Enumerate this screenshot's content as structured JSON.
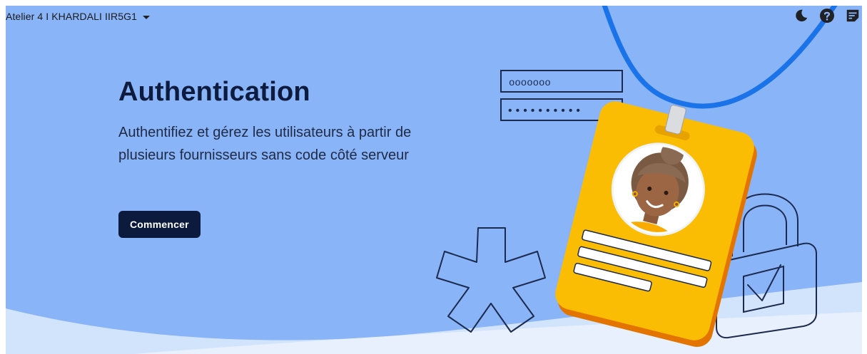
{
  "header": {
    "project_name": "Atelier 4 I KHARDALI IIR5G1",
    "icons": [
      "moon-icon",
      "help-icon",
      "feedback-icon"
    ]
  },
  "hero": {
    "title": "Authentication",
    "description": "Authentifiez et gérez les utilisateurs à partir de plusieurs fournisseurs sans code côté serveur",
    "cta_label": "Commencer"
  },
  "illustration": {
    "username_field": "ooooooo",
    "password_field": "••••••••••"
  },
  "colors": {
    "hero_background": "#8ab4f8",
    "title": "#0d1b3e",
    "cta_background": "#0c1a3d",
    "badge_yellow": "#fbbc04",
    "lanyard_blue": "#1a73e8",
    "outline_navy": "#1b2a4e"
  }
}
